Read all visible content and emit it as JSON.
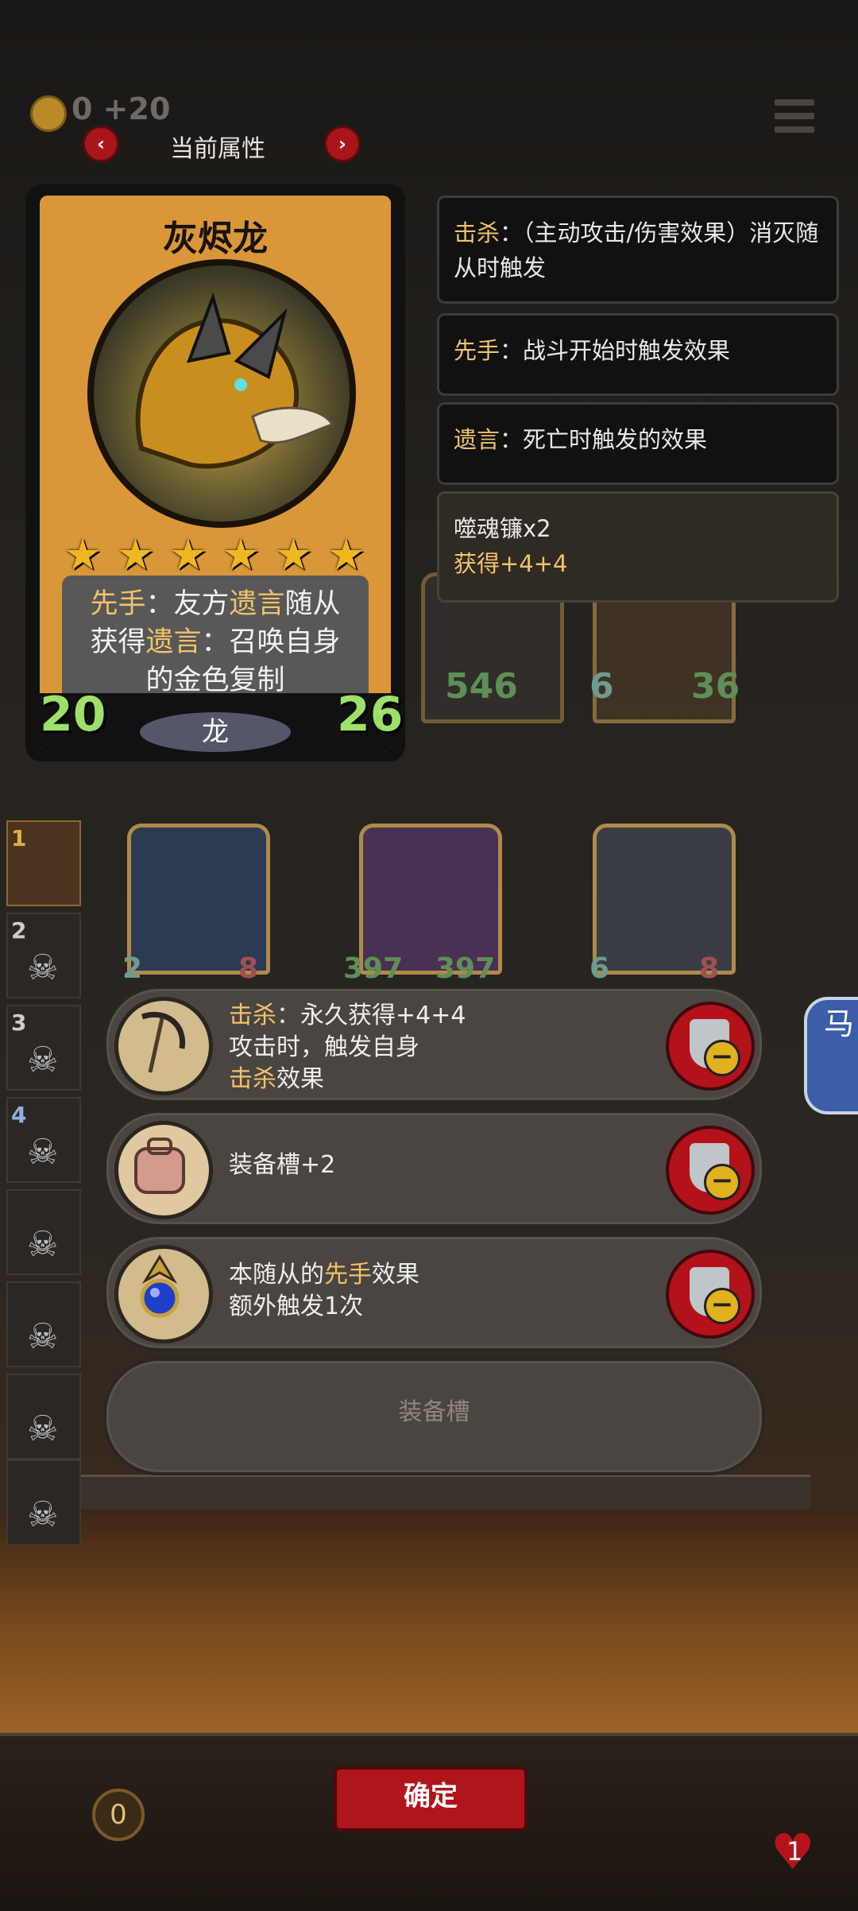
{
  "topbar": {
    "gold_text": "0 +20",
    "attr_label": "当前属性",
    "prev_icon": "chevron-left-icon",
    "next_icon": "chevron-right-icon",
    "prev_glyph": "‹",
    "next_glyph": "›"
  },
  "card": {
    "name": "灰烬龙",
    "stars": 6,
    "ability_parts": [
      {
        "text": "先手",
        "highlight": true
      },
      {
        "text": "：友方",
        "highlight": false
      },
      {
        "text": "遗言",
        "highlight": true
      },
      {
        "text": "随从获得",
        "highlight": false
      },
      {
        "text": "遗言",
        "highlight": true
      },
      {
        "text": "：召唤自身的金色复制",
        "highlight": false
      }
    ],
    "attack": "20",
    "health": "26",
    "tribe": "龙"
  },
  "keywords": [
    {
      "term": "击杀",
      "desc": "：（主动攻击/伤害效果）消灭随从时触发"
    },
    {
      "term": "先手",
      "desc": "：战斗开始时触发效果"
    },
    {
      "term": "遗言",
      "desc": "：死亡时触发的效果"
    }
  ],
  "item_info": {
    "name": "噬魂镰x2",
    "effect": "获得+4+4"
  },
  "board": {
    "row1": [
      {
        "atk": "546",
        "hp": ""
      },
      {
        "atk": "6",
        "hp": "36"
      }
    ],
    "row2": [
      {
        "atk": "2",
        "hp": "8"
      },
      {
        "atk": "397",
        "hp": "397"
      },
      {
        "atk": "6",
        "hp": "8"
      }
    ]
  },
  "equipment": [
    {
      "icon": "scythe-icon",
      "lines": [
        [
          {
            "text": "击杀",
            "highlight": true
          },
          {
            "text": "：永久获得+4+4",
            "highlight": false
          }
        ],
        [
          {
            "text": "攻击时，触发自身",
            "highlight": false
          }
        ],
        [
          {
            "text": "击杀",
            "highlight": true
          },
          {
            "text": "效果",
            "highlight": false
          }
        ]
      ]
    },
    {
      "icon": "backpack-icon",
      "lines": [
        [
          {
            "text": "装备槽+2",
            "highlight": false
          }
        ]
      ]
    },
    {
      "icon": "amulet-icon",
      "lines": [
        [
          {
            "text": "本随从的",
            "highlight": false
          },
          {
            "text": "先手",
            "highlight": true
          },
          {
            "text": "效果",
            "highlight": false
          }
        ],
        [
          {
            "text": "额外触发1次",
            "highlight": false
          }
        ]
      ]
    }
  ],
  "empty_slot_label": "装备槽",
  "sidebar": [
    "1",
    "2",
    "3",
    "4",
    "",
    "",
    "",
    ""
  ],
  "confirm_label": "确定",
  "floating_label": "马",
  "bottom_gold": "0",
  "lives": "1",
  "colors": {
    "highlight": "#f0c36a",
    "stat_green": "#9de06a",
    "button_red": "#b0151b"
  }
}
